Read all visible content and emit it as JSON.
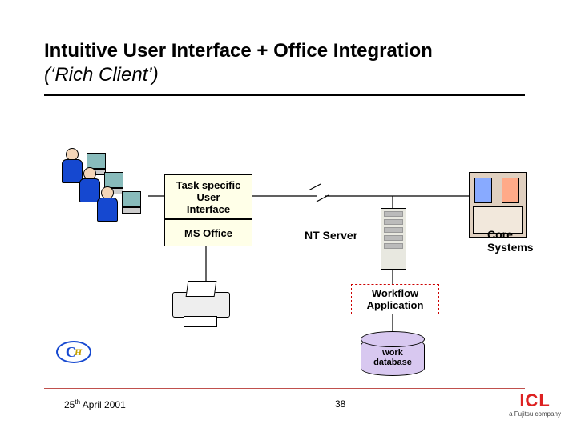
{
  "title": {
    "main": "Intuitive User Interface + Office Integration",
    "sub": "(‘Rich Client’)"
  },
  "diagram": {
    "task_ui_box": "Task specific\nUser\nInterface",
    "ms_office_box": "MS Office",
    "nt_server_label": "NT Server",
    "core_systems_label": "Core\nSystems",
    "workflow_box": "Workflow\nApplication",
    "work_db_label": "work\ndatabase"
  },
  "icons": {
    "users": "users-at-workstations",
    "printer": "laser-printer",
    "server": "tower-server",
    "mainframe": "mainframe-cabinet",
    "db": "database-cylinder",
    "ch_badge": "CH"
  },
  "footer": {
    "date": "25th April 2001",
    "pageno": "38",
    "logo": "ICL",
    "tagline": "a Fujitsu company"
  }
}
